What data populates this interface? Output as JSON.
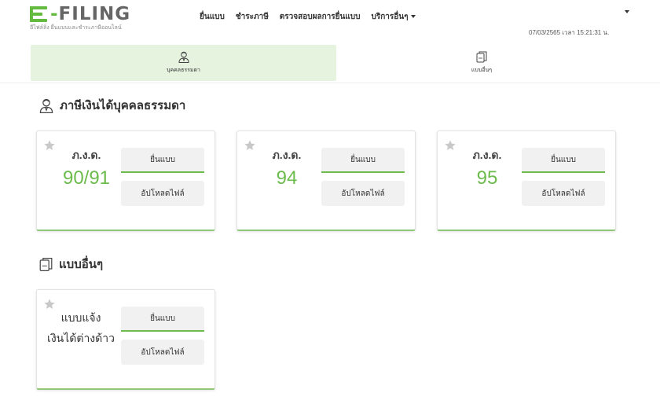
{
  "header": {
    "logo_text": "E-FILING",
    "logo_subtitle": "อีไฟล์ลิ่ง ยื่นแบบและชำระภาษีออนไลน์",
    "nav": [
      {
        "label": "ยื่นแบบ"
      },
      {
        "label": "ชำระภาษี"
      },
      {
        "label": "ตรวจสอบผลการยื่นแบบ"
      },
      {
        "label": "บริการอื่นๆ"
      }
    ],
    "datetime": "07/03/2565 เวลา 15:21:31 น."
  },
  "tabs": [
    {
      "label": "บุคคลธรรมดา",
      "active": true,
      "icon": "person-icon"
    },
    {
      "label": "แบบอื่นๆ",
      "active": false,
      "icon": "document-icon"
    }
  ],
  "sections": {
    "individual": {
      "title": "ภาษีเงินได้บุคคลธรรมดา",
      "icon": "person-icon"
    },
    "other": {
      "title": "แบบอื่นๆ",
      "icon": "document-icon"
    }
  },
  "cards": [
    {
      "label": "ภ.ง.ด.",
      "number": "90/91",
      "file_label": "ยื่นแบบ",
      "upload_label": "อัปโหลดไฟล์"
    },
    {
      "label": "ภ.ง.ด.",
      "number": "94",
      "file_label": "ยื่นแบบ",
      "upload_label": "อัปโหลดไฟล์"
    },
    {
      "label": "ภ.ง.ด.",
      "number": "95",
      "file_label": "ยื่นแบบ",
      "upload_label": "อัปโหลดไฟล์"
    }
  ],
  "other_cards": [
    {
      "line1": "แบบแจ้ง",
      "line2": "เงินได้ต่างด้าว",
      "file_label": "ยื่นแบบ",
      "upload_label": "อัปโหลดไฟล์"
    }
  ],
  "colors": {
    "brand_green": "#6cbb4d",
    "active_tab_bg": "#e6f3df",
    "button_bg": "#f1f1f1"
  }
}
